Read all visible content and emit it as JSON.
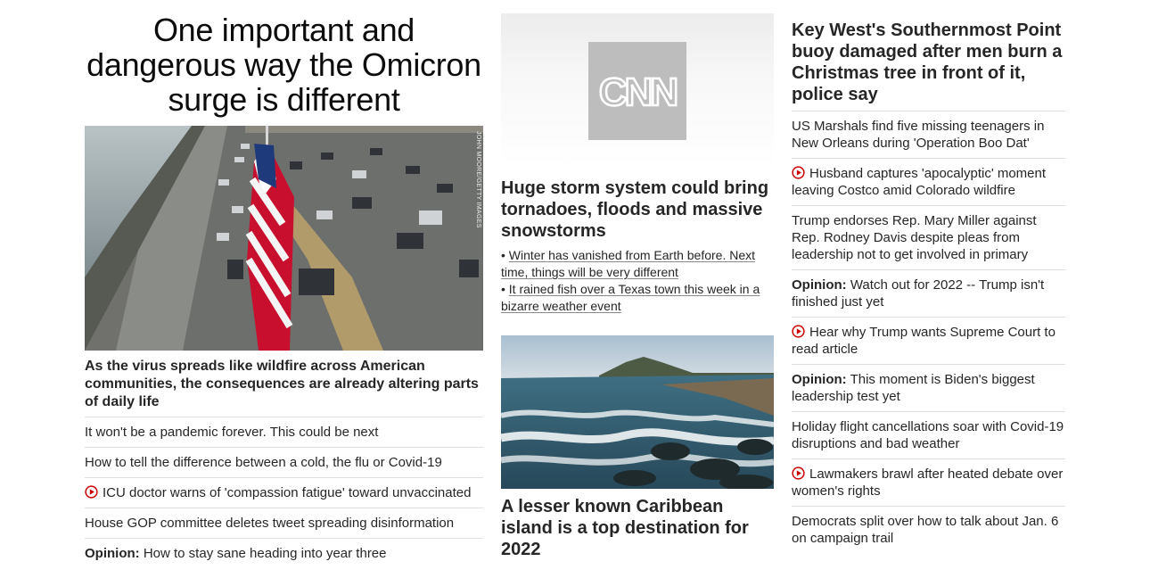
{
  "left": {
    "headline": "One important and dangerous way the Omicron surge is different",
    "image_credit": "JOHN MOORE/GETTY IMAGES",
    "caption": "As the virus spreads like wildfire across American communities, the consequences are already altering parts of daily life",
    "items": [
      {
        "kicker": "",
        "text": "It won't be a pandemic forever. This could be next",
        "video": false
      },
      {
        "kicker": "",
        "text": "How to tell the difference between a cold, the flu or Covid-19",
        "video": false
      },
      {
        "kicker": "",
        "text": "ICU doctor warns of 'compassion fatigue' toward unvaccinated",
        "video": true
      },
      {
        "kicker": "",
        "text": "House GOP committee deletes tweet spreading disinformation",
        "video": false
      },
      {
        "kicker": "Opinion:",
        "text": "How to stay sane heading into year three",
        "video": false
      }
    ]
  },
  "middle": {
    "logo_text": "CNN",
    "storm_headline": "Huge storm system could bring tornadoes, floods and massive snowstorms",
    "bullets": [
      "Winter has vanished from Earth before. Next time, things will be very different",
      "It rained fish over a Texas town this week in a bizarre weather event"
    ],
    "island_headline": "A lesser known Caribbean island is a top destination for 2022"
  },
  "right": {
    "headline": "Key West's Southernmost Point buoy damaged after men burn a Christmas tree in front of it, police say",
    "items": [
      {
        "kicker": "",
        "text": "US Marshals find five missing teenagers in New Orleans during 'Operation Boo Dat'",
        "video": false
      },
      {
        "kicker": "",
        "text": "Husband captures 'apocalyptic' moment leaving Costco amid Colorado wildfire",
        "video": true
      },
      {
        "kicker": "",
        "text": "Trump endorses Rep. Mary Miller against Rep. Rodney Davis despite pleas from leadership not to get involved in primary",
        "video": false
      },
      {
        "kicker": "Opinion:",
        "text": "Watch out for 2022 -- Trump isn't finished just yet",
        "video": false
      },
      {
        "kicker": "",
        "text": "Hear why Trump wants Supreme Court to read article",
        "video": true
      },
      {
        "kicker": "Opinion:",
        "text": "This moment is Biden's biggest leadership test yet",
        "video": false
      },
      {
        "kicker": "",
        "text": "Holiday flight cancellations soar with Covid-19 disruptions and bad weather",
        "video": false
      },
      {
        "kicker": "",
        "text": "Lawmakers brawl after heated debate over women's rights",
        "video": true
      },
      {
        "kicker": "",
        "text": "Democrats split over how to talk about Jan. 6 on campaign trail",
        "video": false
      }
    ]
  },
  "colors": {
    "text": "#262626",
    "divider": "#dedede",
    "video_red": "#cc0000",
    "logo_gray": "#bdbdbd"
  },
  "icons": {
    "video": "play-circle-icon",
    "logo": "cnn-logo-icon"
  }
}
